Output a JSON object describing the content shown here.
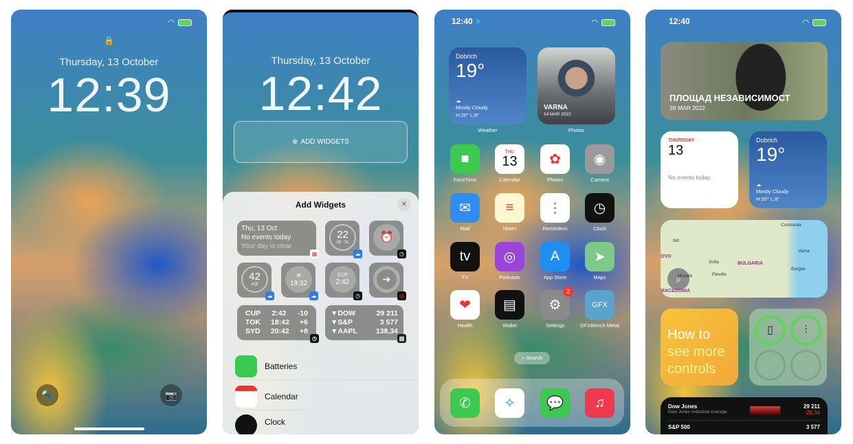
{
  "screen1": {
    "date": "Thursday, 13 October",
    "time": "12:39",
    "icons": [
      "lock-icon",
      "flashlight-icon",
      "camera-icon"
    ]
  },
  "screen2": {
    "date": "Thursday, 13 October",
    "time": "12:42",
    "add_widgets": "ADD WIDGETS",
    "sheet": {
      "title": "Add Widgets",
      "close": "✕",
      "cal": {
        "line1": "Thu, 13 Oct",
        "line2": "No events today",
        "line3": "Your day is clear"
      },
      "temp": {
        "value": "22",
        "low": "18",
        "high": "31"
      },
      "aqi": {
        "value": "42",
        "label": "AQI"
      },
      "sunset": {
        "value": "19:32"
      },
      "cup": {
        "label": "CUP",
        "value": "2:42"
      },
      "clocks": [
        [
          "CUP",
          "2:42",
          "-10"
        ],
        [
          "TOK",
          "18:42",
          "+6"
        ],
        [
          "SYD",
          "20:42",
          "+8"
        ]
      ],
      "stocks": [
        [
          "▼DOW",
          "29 211"
        ],
        [
          "▼S&P",
          "3 577"
        ],
        [
          "▼AAPL",
          "138,34"
        ]
      ],
      "list": [
        "Batteries",
        "Calendar",
        "Clock"
      ]
    }
  },
  "screen3": {
    "time": "12:40",
    "weather": {
      "city": "Dobrich",
      "temp": "19°",
      "cond": "Mostly Cloudy",
      "hl": "H:20° L:8°",
      "label": "Weather"
    },
    "photo": {
      "place": "VARNA",
      "date": "14 MAR 2022",
      "label": "Photos"
    },
    "apps": [
      {
        "name": "FaceTime",
        "bg": "#3bc94f",
        "g": "■"
      },
      {
        "name": "Calendar",
        "bg": "#fff",
        "g": "13",
        "top": "THU"
      },
      {
        "name": "Photos",
        "bg": "#fff",
        "g": "✿"
      },
      {
        "name": "Camera",
        "bg": "#9a9a9a",
        "g": "◉"
      },
      {
        "name": "Mail",
        "bg": "#2f8cf0",
        "g": "✉"
      },
      {
        "name": "Notes",
        "bg": "#fff7d0",
        "g": "≡"
      },
      {
        "name": "Reminders",
        "bg": "#fff",
        "g": "⋮"
      },
      {
        "name": "Clock",
        "bg": "#111",
        "g": "◷"
      },
      {
        "name": "TV",
        "bg": "#111",
        "g": "tv"
      },
      {
        "name": "Podcasts",
        "bg": "#9b45d8",
        "g": "◎"
      },
      {
        "name": "App Store",
        "bg": "#1e8ff0",
        "g": "A"
      },
      {
        "name": "Maps",
        "bg": "#7cc98a",
        "g": "➤"
      },
      {
        "name": "Health",
        "bg": "#fff",
        "g": "❤"
      },
      {
        "name": "Wallet",
        "bg": "#111",
        "g": "▤"
      },
      {
        "name": "Settings",
        "bg": "#8a8a8a",
        "g": "⚙",
        "badge": "2"
      },
      {
        "name": "GFXBench Metal",
        "bg": "#5aa3cf",
        "g": "GFX"
      }
    ],
    "search": "Search",
    "dock": [
      {
        "name": "phone",
        "bg": "#3bc94f",
        "g": "✆"
      },
      {
        "name": "safari",
        "bg": "#fff",
        "g": "✧"
      },
      {
        "name": "messages",
        "bg": "#3bc94f",
        "g": "💬"
      },
      {
        "name": "music",
        "bg": "#f0384e",
        "g": "♫"
      }
    ]
  },
  "screen4": {
    "time": "12:40",
    "photo": {
      "place": "ПЛОЩАД НЕЗАВИСИМОСТ",
      "date": "28 MAR 2022"
    },
    "calendar": {
      "day": "THURSDAY",
      "num": "13",
      "events": "No events today"
    },
    "weather": {
      "city": "Dobrich",
      "temp": "19°",
      "cond": "Mostly Cloudy",
      "hl": "H:20° L:8°"
    },
    "map": {
      "labels": [
        "Constanța",
        "Niš",
        "Varna",
        "Sofia",
        "BULGARIA",
        "Burgas",
        "Musala",
        "Plovdiv",
        "OVO",
        "MACEDONIA"
      ]
    },
    "howto": {
      "l1": "How to",
      "l2": "see more",
      "l3": "controls"
    },
    "stocks": [
      {
        "sym": "Dow Jones",
        "desc": "Dow Jones Industrial Average",
        "price": "29 211",
        "chg": "-28,34"
      },
      {
        "sym": "S&P 500",
        "price": "3 577"
      }
    ]
  },
  "colors": {
    "accent_red": "#f03a2e",
    "battery_green": "#5fd35a",
    "howto_yellow": "#f5b52e"
  }
}
